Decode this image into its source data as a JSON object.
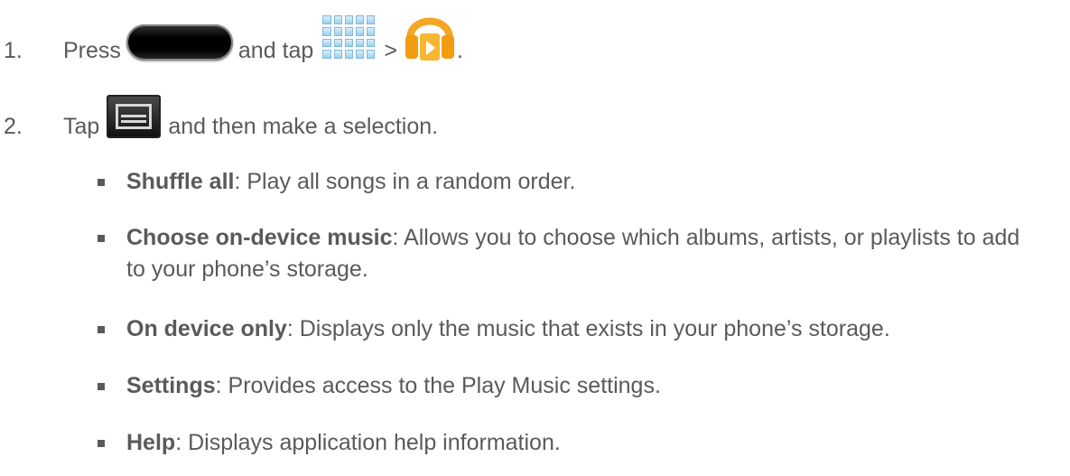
{
  "steps": [
    {
      "number": "1.",
      "parts": [
        "Press",
        "and tap",
        ">",
        "."
      ],
      "icons": [
        "home-key-icon",
        "apps-grid-icon",
        "play-music-headphones-icon"
      ]
    },
    {
      "number": "2.",
      "parts": [
        "Tap",
        "and then make a selection."
      ],
      "icons": [
        "menu-key-icon"
      ]
    }
  ],
  "options": [
    {
      "term": "Shuffle all",
      "desc": ": Play all songs in a random order."
    },
    {
      "term": "Choose on-device music",
      "desc": ": Allows you to choose which albums, artists, or playlists to add to your phone’s storage."
    },
    {
      "term": "On device only",
      "desc": ": Displays only the music that exists in your phone’s storage."
    },
    {
      "term": "Settings",
      "desc": ": Provides access to the Play Music settings."
    },
    {
      "term": "Help",
      "desc": ": Displays application help information."
    }
  ],
  "colors": {
    "text": "#5a5a5a",
    "music_icon_orange": "#f5a623"
  }
}
